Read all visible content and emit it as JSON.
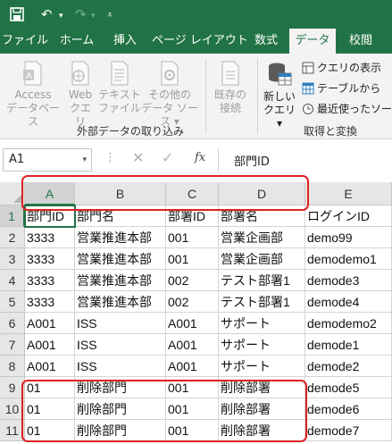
{
  "titlebar": {
    "icons": [
      "save-icon",
      "undo-icon",
      "redo-icon",
      "customize-qat-icon"
    ],
    "undo_glyph": "↶",
    "redo_glyph": "↷",
    "dropdown_glyph": "▾",
    "qat_glyph": "⩡"
  },
  "tabs": [
    "ファイル",
    "ホーム",
    "挿入",
    "ページ レイアウト",
    "数式",
    "データ",
    "校閲"
  ],
  "active_tab": "データ",
  "ribbon": {
    "buttons": [
      {
        "line1": "Access",
        "line2": "データベース",
        "icon": "access-icon",
        "enabled": false
      },
      {
        "line1": "Web",
        "line2": "クエリ",
        "icon": "web-query-icon",
        "enabled": false
      },
      {
        "line1": "テキスト",
        "line2": "ファイル",
        "icon": "text-file-icon",
        "enabled": false
      },
      {
        "line1": "その他の",
        "line2": "データ ソース ▾",
        "icon": "other-sources-icon",
        "enabled": false
      },
      {
        "line1": "既存の",
        "line2": "接続",
        "icon": "existing-connections-icon",
        "enabled": false
      },
      {
        "line1": "新しい",
        "line2": "クエリ ▾",
        "icon": "new-query-icon",
        "enabled": true
      }
    ],
    "small_buttons": [
      {
        "label": "クエリの表示",
        "icon": "show-queries-icon"
      },
      {
        "label": "テーブルから",
        "icon": "from-table-icon"
      },
      {
        "label": "最近使ったソース",
        "icon": "recent-sources-icon"
      }
    ],
    "groups": [
      "外部データの取り込み",
      "取得と変換"
    ]
  },
  "formula_bar": {
    "name_box": "A1",
    "dropdown_glyph": "▾",
    "dots": "⋮",
    "cancel_glyph": "✕",
    "enter_glyph": "✓",
    "fx": "fx",
    "content": "部門ID"
  },
  "sheet": {
    "columns": [
      "A",
      "B",
      "C",
      "D",
      "E"
    ],
    "rows": [
      {
        "num": "1",
        "cells": [
          "部門ID",
          "部門名",
          "部署ID",
          "部署名",
          "ログインID"
        ]
      },
      {
        "num": "2",
        "cells": [
          "3333",
          "営業推進本部",
          "001",
          "営業企画部",
          "demo99"
        ]
      },
      {
        "num": "3",
        "cells": [
          "3333",
          "営業推進本部",
          "001",
          "営業企画部",
          "demodemo1"
        ]
      },
      {
        "num": "4",
        "cells": [
          "3333",
          "営業推進本部",
          "002",
          "テスト部署1",
          "demode3"
        ]
      },
      {
        "num": "5",
        "cells": [
          "3333",
          "営業推進本部",
          "002",
          "テスト部署1",
          "demode4"
        ]
      },
      {
        "num": "6",
        "cells": [
          "A001",
          "ISS",
          "A001",
          "サポート",
          "demodemo2"
        ]
      },
      {
        "num": "7",
        "cells": [
          "A001",
          "ISS",
          "A001",
          "サポート",
          "demode1"
        ]
      },
      {
        "num": "8",
        "cells": [
          "A001",
          "ISS",
          "A001",
          "サポート",
          "demode2"
        ]
      },
      {
        "num": "9",
        "cells": [
          "01",
          "削除部門",
          "001",
          "削除部署",
          "demode5"
        ]
      },
      {
        "num": "10",
        "cells": [
          "01",
          "削除部門",
          "001",
          "削除部署",
          "demode6"
        ]
      },
      {
        "num": "11",
        "cells": [
          "01",
          "削除部門",
          "001",
          "削除部署",
          "demode7"
        ]
      }
    ]
  },
  "annotation_color": "#e02020",
  "accent_color": "#217346"
}
